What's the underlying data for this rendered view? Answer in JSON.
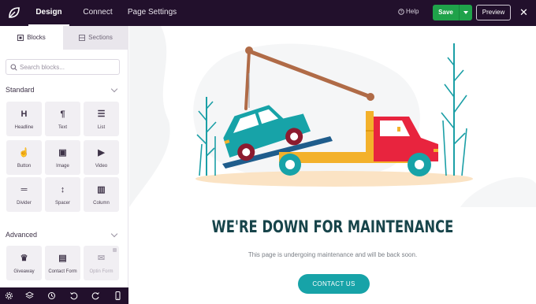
{
  "topbar": {
    "tabs": [
      "Design",
      "Connect",
      "Page Settings"
    ],
    "help_label": "Help",
    "save_label": "Save",
    "preview_label": "Preview"
  },
  "sidebar": {
    "tab_blocks": "Blocks",
    "tab_sections": "Sections",
    "search_placeholder": "Search blocks...",
    "standard_label": "Standard",
    "standard_blocks": [
      {
        "label": "Headline",
        "icon": "H"
      },
      {
        "label": "Text",
        "icon": "¶"
      },
      {
        "label": "List",
        "icon": "☰"
      },
      {
        "label": "Button",
        "icon": "☝"
      },
      {
        "label": "Image",
        "icon": "▣"
      },
      {
        "label": "Video",
        "icon": "▶"
      },
      {
        "label": "Divider",
        "icon": "═"
      },
      {
        "label": "Spacer",
        "icon": "↕"
      },
      {
        "label": "Column",
        "icon": "▥"
      }
    ],
    "advanced_label": "Advanced",
    "advanced_blocks": [
      {
        "label": "Giveaway",
        "icon": "♛"
      },
      {
        "label": "Contact Form",
        "icon": "▤"
      },
      {
        "label": "Optin Form",
        "icon": "✉"
      }
    ]
  },
  "page": {
    "headline": "WE'RE DOWN FOR MAINTENANCE",
    "subtext": "This page is undergoing maintenance and will be back soon.",
    "cta_label": "CONTACT US"
  },
  "colors": {
    "topbar": "#22102c",
    "save": "#1fa24a",
    "headline": "#17444a",
    "cta": "#17a3a8"
  }
}
